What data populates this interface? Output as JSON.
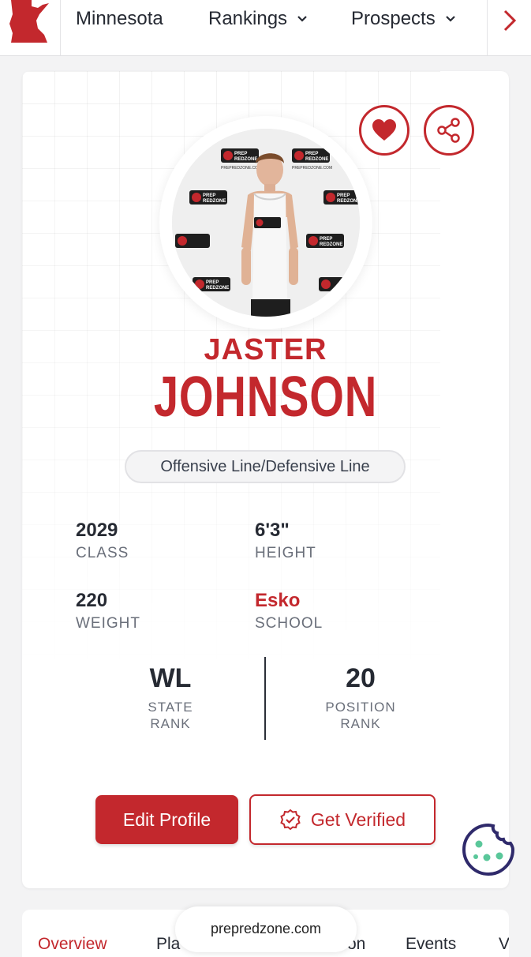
{
  "topnav": {
    "items": [
      {
        "label": "Minnesota"
      },
      {
        "label": "Rankings"
      },
      {
        "label": "Prospects"
      }
    ]
  },
  "colors": {
    "brand_red": "#c3282d",
    "text_dark": "#262a33",
    "muted": "#6a6f7a"
  },
  "icons": [
    "minnesota-state-icon",
    "chevron-down-icon",
    "chevron-right-icon",
    "heart-icon",
    "share-icon",
    "verified-badge-icon",
    "cookie-icon"
  ],
  "player": {
    "first_name": "JASTER",
    "last_name": "JOHNSON",
    "position": "Offensive Line/Defensive Line",
    "stats": {
      "class_value": "2029",
      "class_label": "CLASS",
      "height_value": "6'3\"",
      "height_label": "HEIGHT",
      "weight_value": "220",
      "weight_label": "WEIGHT",
      "school_value": "Esko",
      "school_label": "SCHOOL"
    },
    "ranks": {
      "state_value": "WL",
      "state_label_1": "STATE",
      "state_label_2": "RANK",
      "position_value": "20",
      "position_label_1": "POSITION",
      "position_label_2": "RANK"
    },
    "photo_backdrop_text": [
      "PREP",
      "REDZONE",
      "PREPREDZONE.COM"
    ]
  },
  "actions": {
    "edit_label": "Edit Profile",
    "verify_label": "Get Verified"
  },
  "tabs": [
    {
      "label": "Overview",
      "active": true
    },
    {
      "label": "Pla"
    },
    {
      "label": "on"
    },
    {
      "label": "Events"
    },
    {
      "label": "V"
    }
  ],
  "browser": {
    "url": "prepredzone.com"
  }
}
